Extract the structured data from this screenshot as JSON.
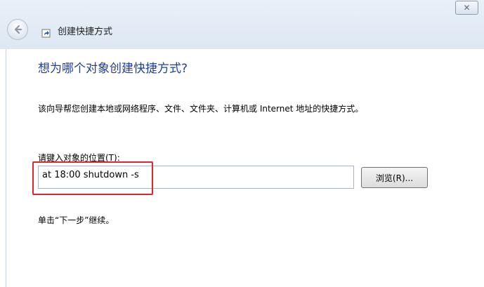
{
  "window": {
    "title": "创建快捷方式",
    "close_glyph": "✕"
  },
  "page": {
    "heading": "想为哪个对象创建快捷方式?",
    "description": "该向导帮您创建本地或网络程序、文件、文件夹、计算机或 Internet 地址的快捷方式。",
    "field_label": "请键入对象的位置(T):",
    "location_value": "at 18:00 shutdown -s",
    "browse_label": "浏览(R)...",
    "hint": "单击“下一步”继续。"
  },
  "colors": {
    "heading": "#1f3f98",
    "highlight": "#e2242b"
  },
  "icons": [
    "back-arrow-icon",
    "shortcut-icon",
    "close-icon"
  ]
}
